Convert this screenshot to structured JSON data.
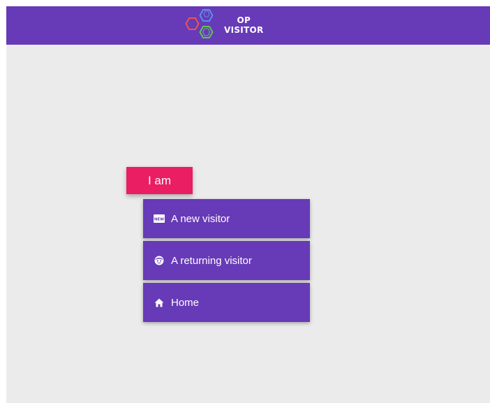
{
  "app": {
    "logo_line1": "OP",
    "logo_line2": "VISITOR",
    "logo_icon": "hexagons-logo-icon"
  },
  "colors": {
    "header": "#673ab7",
    "accent": "#e91e63",
    "background": "#ebebeb",
    "button": "#673ab7"
  },
  "prompt": {
    "label": "I am"
  },
  "menu": {
    "items": [
      {
        "label": "A new visitor",
        "icon": "new-badge-icon"
      },
      {
        "label": "A returning visitor",
        "icon": "face-icon"
      },
      {
        "label": "Home",
        "icon": "home-icon"
      }
    ]
  }
}
